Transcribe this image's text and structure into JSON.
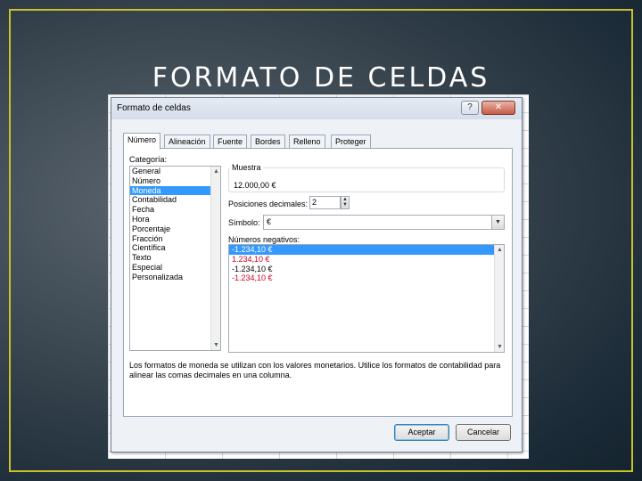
{
  "slide": {
    "title": "FORMATO DE CELDAS",
    "frame_color": "#c9c02e"
  },
  "dialog": {
    "title": "Formato de celdas",
    "help_label": "?",
    "close_label": "✕",
    "tabs": [
      "Número",
      "Alineación",
      "Fuente",
      "Bordes",
      "Relleno",
      "Proteger"
    ],
    "active_tab": "Número",
    "category_label": "Categoría:",
    "categories": [
      "General",
      "Número",
      "Moneda",
      "Contabilidad",
      "Fecha",
      "Hora",
      "Porcentaje",
      "Fracción",
      "Científica",
      "Texto",
      "Especial",
      "Personalizada"
    ],
    "selected_category": "Moneda",
    "sample_label": "Muestra",
    "sample_value": "12.000,00 €",
    "decimals_label": "Posiciones decimales:",
    "decimals_value": "2",
    "symbol_label": "Símbolo:",
    "symbol_value": "€",
    "negatives_label": "Números negativos:",
    "negatives": [
      {
        "text": "-1.234,10 €",
        "red": false,
        "selected": true
      },
      {
        "text": "1.234,10 €",
        "red": true,
        "selected": false
      },
      {
        "text": "-1.234,10 €",
        "red": false,
        "selected": false
      },
      {
        "text": "-1.234,10 €",
        "red": true,
        "selected": false
      }
    ],
    "description": "Los formatos de moneda se utilizan con los valores monetarios. Utilice los formatos de contabilidad para alinear las comas decimales en una columna.",
    "ok_label": "Aceptar",
    "cancel_label": "Cancelar"
  },
  "icons": {
    "scroll_up": "scroll-up-arrow-icon",
    "scroll_down": "scroll-down-arrow-icon",
    "spin": "spin-arrows-icon",
    "dropdown": "chevron-down-icon"
  },
  "colors": {
    "selection": "#3399ff",
    "negative_red": "#d0021b",
    "dialog_bg": "#eef2f7"
  }
}
